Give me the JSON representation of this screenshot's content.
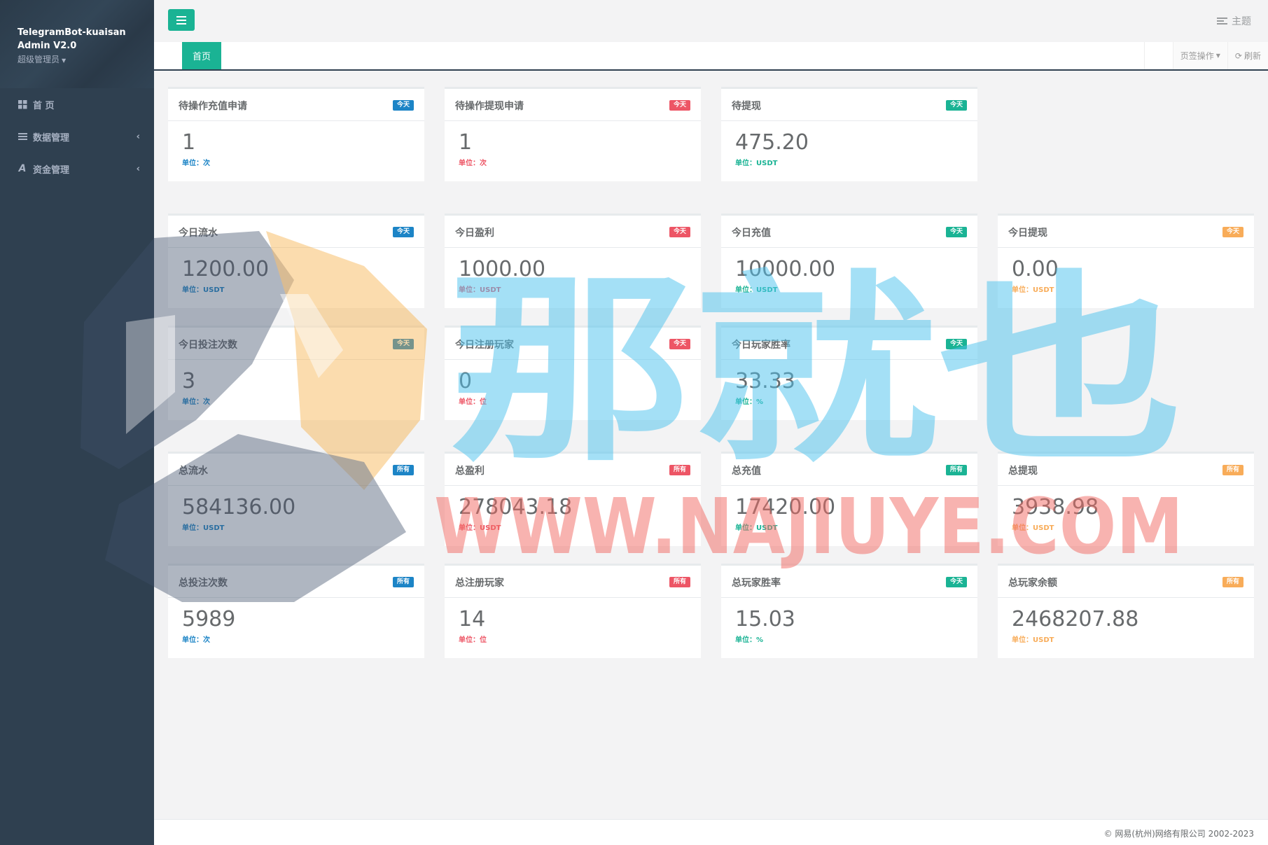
{
  "sidebar": {
    "app_name": "TelegramBot-kuaisan Admin V2.0",
    "role": "超级管理员",
    "items": [
      {
        "label": "首 页",
        "icon": "dashboard-grid-icon"
      },
      {
        "label": "数据管理",
        "icon": "list-icon"
      },
      {
        "label": "资金管理",
        "icon": "font-a-icon"
      }
    ],
    "expand_glyph": "‹"
  },
  "topbar": {
    "theme_label": "主题"
  },
  "tabs": {
    "active_tab": "首页",
    "page_ops_label": "页签操作",
    "refresh_label": "刷新"
  },
  "cards": [
    {
      "title": "待操作充值申请",
      "badge": "今天",
      "value": "1",
      "unit": "单位：次",
      "color": "#1c84c6"
    },
    {
      "title": "待操作提现申请",
      "badge": "今天",
      "value": "1",
      "unit": "单位：次",
      "color": "#ed5565"
    },
    {
      "title": "待提现",
      "badge": "今天",
      "value": "475.20",
      "unit": "单位：USDT",
      "color": "#1ab394"
    },
    {
      "title": "今日流水",
      "badge": "今天",
      "value": "1200.00",
      "unit": "单位：USDT",
      "color": "#1c84c6"
    },
    {
      "title": "今日盈利",
      "badge": "今天",
      "value": "1000.00",
      "unit": "单位：USDT",
      "color": "#ed5565"
    },
    {
      "title": "今日充值",
      "badge": "今天",
      "value": "10000.00",
      "unit": "单位：USDT",
      "color": "#1ab394"
    },
    {
      "title": "今日提现",
      "badge": "今天",
      "value": "0.00",
      "unit": "单位：USDT",
      "color": "#f8ac59"
    },
    {
      "title": "今日投注次数",
      "badge": "今天",
      "value": "3",
      "unit": "单位：次",
      "color": "#1c84c6"
    },
    {
      "title": "今日注册玩家",
      "badge": "今天",
      "value": "0",
      "unit": "单位：位",
      "color": "#ed5565"
    },
    {
      "title": "今日玩家胜率",
      "badge": "今天",
      "value": "33.33",
      "unit": "单位：%",
      "color": "#1ab394"
    },
    {
      "title": "总流水",
      "badge": "所有",
      "value": "584136.00",
      "unit": "单位：USDT",
      "color": "#1c84c6"
    },
    {
      "title": "总盈利",
      "badge": "所有",
      "value": "278043.18",
      "unit": "单位：USDT",
      "color": "#ed5565"
    },
    {
      "title": "总充值",
      "badge": "所有",
      "value": "17420.00",
      "unit": "单位：USDT",
      "color": "#1ab394"
    },
    {
      "title": "总提现",
      "badge": "所有",
      "value": "3938.98",
      "unit": "单位：USDT",
      "color": "#f8ac59"
    },
    {
      "title": "总投注次数",
      "badge": "所有",
      "value": "5989",
      "unit": "单位：次",
      "color": "#1c84c6"
    },
    {
      "title": "总注册玩家",
      "badge": "所有",
      "value": "14",
      "unit": "单位：位",
      "color": "#ed5565"
    },
    {
      "title": "总玩家胜率",
      "badge": "今天",
      "value": "15.03",
      "unit": "单位：%",
      "color": "#1ab394"
    },
    {
      "title": "总玩家余额",
      "badge": "所有",
      "value": "2468207.88",
      "unit": "单位：USDT",
      "color": "#f8ac59"
    }
  ],
  "footer": {
    "copyright": "© 网易(杭州)网络有限公司 2002-2023"
  },
  "watermark": {
    "chinese": "那就也",
    "url": "WWW.NAJIUYE.COM"
  }
}
